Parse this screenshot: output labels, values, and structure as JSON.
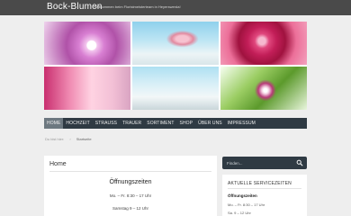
{
  "header": {
    "brand": "Bock-Blumen",
    "tagline": "Willkommen beim Floristmeisterteam in Heyerswerda!"
  },
  "banner": {
    "images": [
      "pink-flower-image",
      "table-bouquet-image",
      "pink-rose-image",
      "champagne-image",
      "table-setting-image",
      "leaf-flower-image"
    ]
  },
  "nav": {
    "items": [
      {
        "label": "HOME",
        "active": true
      },
      {
        "label": "HOCHZEIT",
        "active": false
      },
      {
        "label": "STRAUSS",
        "active": false
      },
      {
        "label": "TRAUER",
        "active": false
      },
      {
        "label": "SORTIMENT",
        "active": false
      },
      {
        "label": "SHOP",
        "active": false
      },
      {
        "label": "ÜBER UNS",
        "active": false
      },
      {
        "label": "IMPRESSUM",
        "active": false
      }
    ]
  },
  "breadcrumb": {
    "home": "Du bist hier:",
    "current": "Startseite"
  },
  "main": {
    "title": "Home",
    "hours_title": "Öffnungszeiten",
    "hours": [
      "Mo. – Fr. 8:30 – 17 Uhr",
      "Samstag 9 – 12 Uhr"
    ]
  },
  "search": {
    "placeholder": "Finden..."
  },
  "widget": {
    "title": "AKTUELLE SERVICEZEITEN",
    "subtitle": "Öffnungszeiten",
    "lines": [
      "Mo. – Fr. 8:30 – 17 Uhr",
      "Sa. 9 – 12 Uhr"
    ]
  },
  "colors": {
    "topbar": "#4a4a4a",
    "nav": "#2f3a43",
    "nav_active": "#6d7880"
  }
}
